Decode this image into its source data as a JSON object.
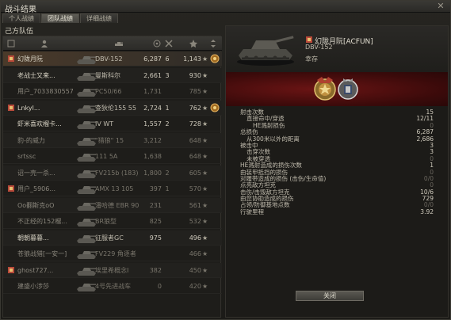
{
  "window": {
    "title": "战斗结果"
  },
  "tabs": [
    {
      "label": "个人战绩",
      "active": false
    },
    {
      "label": "团队战绩",
      "active": true
    },
    {
      "label": "详细战绩",
      "active": false
    }
  ],
  "team": {
    "label": "己方队伍"
  },
  "players": [
    {
      "name": "幻陇月阮",
      "tank": "DBV-152",
      "damage": "6,287",
      "kills": "6",
      "xp": "1,143",
      "self": true,
      "alive": true,
      "medal": true,
      "platoon": true
    },
    {
      "name": "老战士又来...",
      "tank": "曼斯科尔",
      "damage": "2,661",
      "kills": "3",
      "xp": "930",
      "alive": true
    },
    {
      "name": "用户_70338305570",
      "tank": "PC50/66",
      "damage": "1,731",
      "kills": "",
      "xp": "785",
      "alive": false
    },
    {
      "name": "Lnkyl...",
      "tank": "查狄伦155 55",
      "damage": "2,724",
      "kills": "1",
      "xp": "762",
      "alive": true,
      "medal": true,
      "platoon": true
    },
    {
      "name": "虾米喜欢榴卡...",
      "tank": "IV WT",
      "damage": "1,557",
      "kills": "2",
      "xp": "728",
      "alive": true
    },
    {
      "name": "豹-的威力",
      "tank": "\"猎狼\" 15",
      "damage": "3,212",
      "kills": "",
      "xp": "648",
      "alive": false
    },
    {
      "name": "srtssc",
      "tank": "111 5A",
      "damage": "1,638",
      "kills": "",
      "xp": "648",
      "alive": false
    },
    {
      "name": "诏一壳一杀...",
      "tank": "FV215b (183)",
      "damage": "1,800",
      "kills": "2",
      "xp": "605",
      "alive": false
    },
    {
      "name": "用户_5906...",
      "tank": "AMX 13 105",
      "damage": "397",
      "kills": "1",
      "xp": "570",
      "alive": false,
      "platoon": true
    },
    {
      "name": "Oo翻斯克oO",
      "tank": "潘哈德 EBR 90",
      "damage": "231",
      "kills": "",
      "xp": "561",
      "alive": false
    },
    {
      "name": "不正经的152榴...",
      "tank": "BR狼型",
      "damage": "825",
      "kills": "",
      "xp": "532",
      "alive": false
    },
    {
      "name": "朝朝暮暮...",
      "tank": "征服者GC",
      "damage": "975",
      "kills": "",
      "xp": "496",
      "alive": true
    },
    {
      "name": "苍狼战猎[一安一]",
      "tank": "FV229 角逐者",
      "damage": "",
      "kills": "",
      "xp": "466",
      "alive": false
    },
    {
      "name": "ghost727...",
      "tank": "埃里希概念I",
      "damage": "382",
      "kills": "",
      "xp": "450",
      "alive": false,
      "platoon": true
    },
    {
      "name": "建盛小涉莎",
      "tank": "4号先进战车",
      "damage": "0",
      "kills": "",
      "xp": "420",
      "alive": false
    }
  ],
  "detail": {
    "player_name": "幻陇月阮[ACFUN]",
    "tank_name": "DBV-152",
    "status": "幸存",
    "stats": [
      {
        "label": "射击次数",
        "value": "15",
        "indent": 0
      },
      {
        "label": "直接命中/穿透",
        "value": "12/11",
        "indent": 1
      },
      {
        "label": "HE溅射损伤",
        "value": "0",
        "indent": 2,
        "zero": true
      },
      {
        "label": "总损伤",
        "value": "6,287",
        "indent": 0
      },
      {
        "label": "从300米以外的距离",
        "value": "2,686",
        "indent": 1
      },
      {
        "label": "被击中",
        "value": "3",
        "indent": 0
      },
      {
        "label": "击穿次数",
        "value": "3",
        "indent": 1
      },
      {
        "label": "未被穿透",
        "value": "0",
        "indent": 1,
        "zero": true
      },
      {
        "label": "HE溅射造成的损伤次数",
        "value": "1",
        "indent": 0
      },
      {
        "label": "由装甲抵挡的损伤",
        "value": "0",
        "indent": 0,
        "zero": true
      },
      {
        "label": "对履带造成的损伤 (击伤/生命值)",
        "value": "0/0",
        "indent": 0,
        "zero": true
      },
      {
        "label": "点亮敌方坦克",
        "value": "0",
        "indent": 0,
        "zero": true
      },
      {
        "label": "击伤/击毁敌方坦克",
        "value": "10/6",
        "indent": 0
      },
      {
        "label": "由您协助造成的损伤",
        "value": "729",
        "indent": 0
      },
      {
        "label": "占领/防御基地点数",
        "value": "0/0",
        "indent": 0,
        "zero": true
      },
      {
        "label": "行驶里程",
        "value": "3.92",
        "indent": 0
      }
    ]
  },
  "buttons": {
    "close": "关闭"
  }
}
